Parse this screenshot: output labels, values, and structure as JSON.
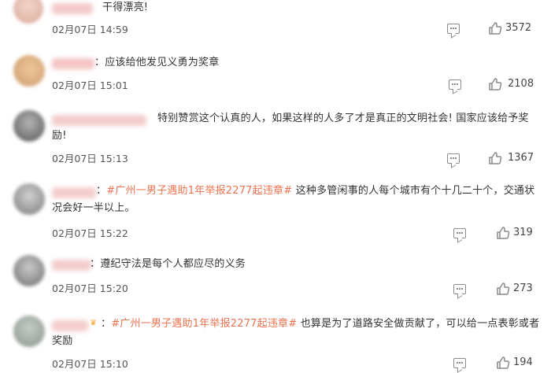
{
  "comments": [
    {
      "text": "干得漂亮!",
      "hashtag": "",
      "time": "02月07日 14:59",
      "likes": "3572",
      "avatar_color": "#e9c5b8"
    },
    {
      "text": "应该给他发见义勇为奖章",
      "hashtag": "",
      "time": "02月07日 15:01",
      "likes": "2108",
      "avatar_color": "#e6b98e"
    },
    {
      "text_line1": "特别赞赏这个认真的人，如果这样的人多了才是真正的文明社会! 国家应该给予奖",
      "text_line2": "励!",
      "hashtag": "",
      "time": "02月07日 15:13",
      "likes": "1367",
      "avatar_color": "#6f6f6f"
    },
    {
      "hashtag": "#广州一男子遇助1年举报2277起违章#",
      "text_line1": "这种多管闲事的人每个城市有个十几二十个，交通状",
      "text_line2": "况会好一半以上。",
      "time": "02月07日 15:22",
      "likes": "319",
      "avatar_color": "#9a9a9a"
    },
    {
      "text": "遵纪守法是每个人都应尽的义务",
      "hashtag": "",
      "time": "02月07日 15:20",
      "likes": "273",
      "avatar_color": "#8c8c8c"
    },
    {
      "hashtag": "#广州一男子遇助1年举报2277起违章#",
      "text_line1": "也算是为了道路安全做贡献了，可以给一点表彰或者",
      "text_line2": "奖励",
      "time": "02月07日 15:10",
      "likes": "194",
      "avatar_color": "#a8b0aa"
    }
  ],
  "icons": {
    "comment": "comment-icon",
    "like": "thumbs-up-icon"
  }
}
